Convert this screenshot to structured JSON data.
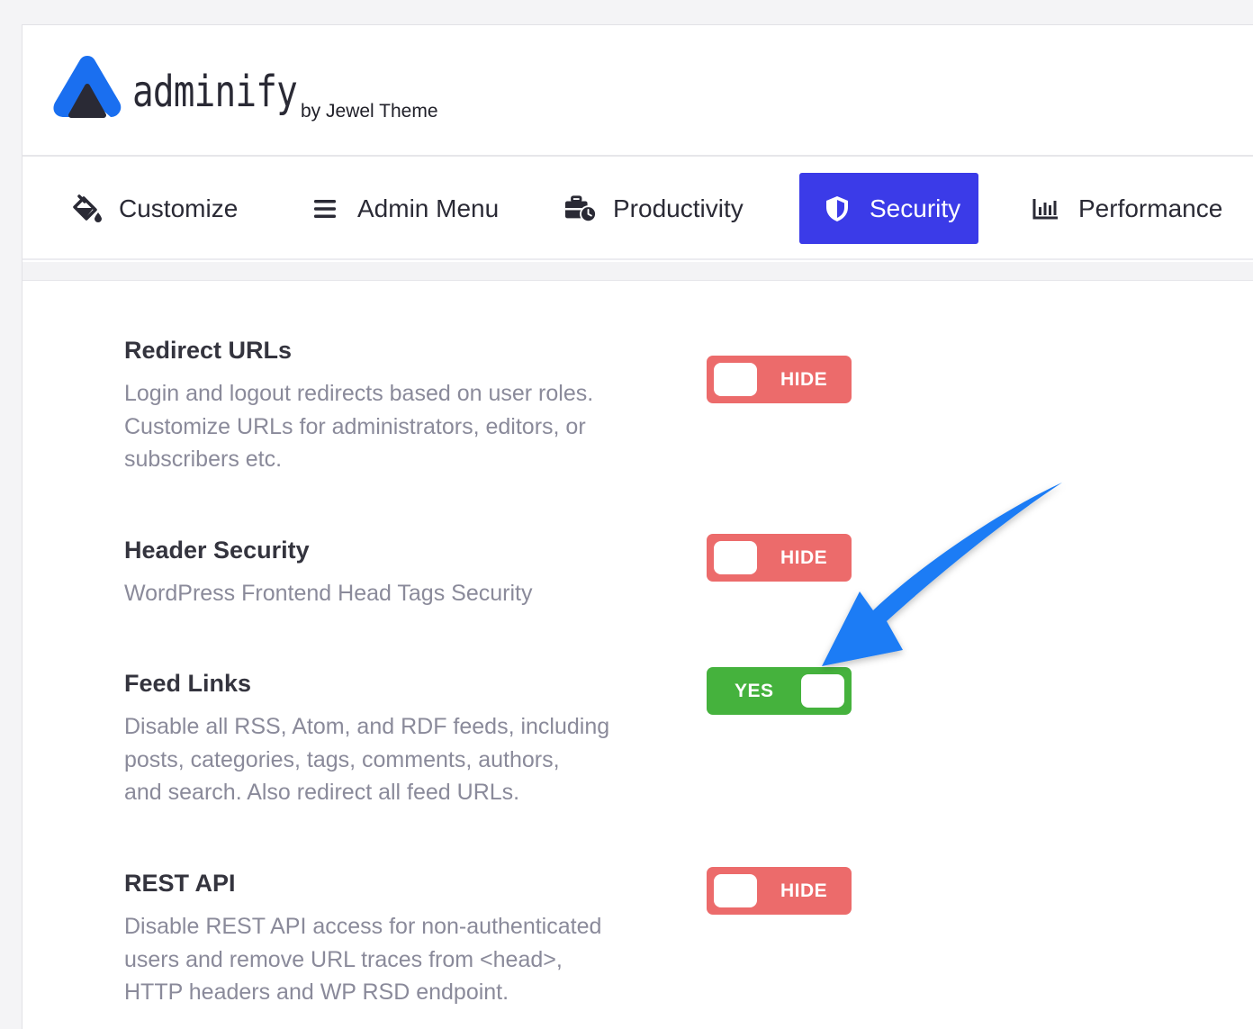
{
  "brand": {
    "name": "adminify",
    "byline": "by Jewel Theme",
    "logo_icon": "adminify-logo-icon",
    "accent": "#1a6ff0"
  },
  "tabs": [
    {
      "label": "Customize",
      "icon": "paint-bucket-icon",
      "active": false
    },
    {
      "label": "Admin Menu",
      "icon": "menu-lines-icon",
      "active": false
    },
    {
      "label": "Productivity",
      "icon": "briefcase-clock-icon",
      "active": false
    },
    {
      "label": "Security",
      "icon": "shield-icon",
      "active": true
    },
    {
      "label": "Performance",
      "icon": "bar-chart-icon",
      "active": false
    }
  ],
  "settings": [
    {
      "title": "Redirect URLs",
      "desc": [
        "Login and logout redirects based on user roles.",
        "Customize URLs for administrators, editors, or",
        "subscribers etc."
      ],
      "toggle": "HIDE",
      "state": "off"
    },
    {
      "title": "Header Security",
      "desc": [
        "WordPress Frontend Head Tags Security"
      ],
      "toggle": "HIDE",
      "state": "off"
    },
    {
      "title": "Feed Links",
      "desc": [
        "Disable all RSS, Atom, and RDF feeds, including",
        "posts, categories, tags, comments, authors,",
        "and search. Also redirect all feed URLs."
      ],
      "toggle": "YES",
      "state": "on"
    },
    {
      "title": "REST API",
      "desc": [
        "Disable REST API access for non-authenticated",
        "users and remove URL traces from <head>,",
        "HTTP headers and WP RSD endpoint."
      ],
      "toggle": "HIDE",
      "state": "off"
    }
  ],
  "colors": {
    "active_tab": "#3b3be8",
    "toggle_off": "#ec6b6b",
    "toggle_on": "#45b23d",
    "annotation_arrow": "#1a7cf5"
  }
}
